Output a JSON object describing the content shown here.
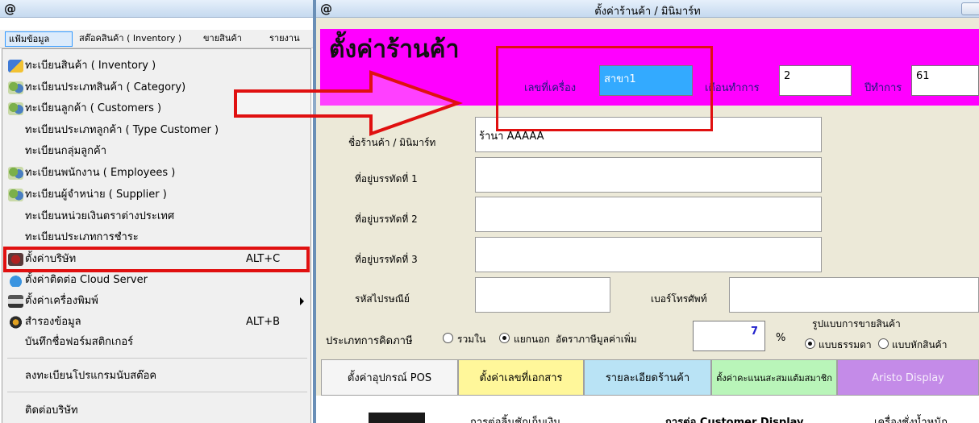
{
  "left_window": {
    "logo": "@",
    "menubar": [
      {
        "label": "แฟ้มข้อมูล",
        "active": true
      },
      {
        "label": "สต๊อคสินค้า ( Inventory )"
      },
      {
        "label": "ขายสินค้า"
      },
      {
        "label": "รายงาน"
      }
    ],
    "menu_items": [
      {
        "label": "ทะเบียนสินค้า ( Inventory )",
        "icon": "product-list-icon"
      },
      {
        "label": "ทะเบียนประเภทสินค้า ( Category)",
        "icon": "people-icon"
      },
      {
        "label": "ทะเบียนลูกค้า ( Customers )",
        "icon": "people-icon"
      },
      {
        "label": "ทะเบียนประเภทลูกค้า ( Type Customer )"
      },
      {
        "label": "ทะเบียนกลุ่มลูกค้า"
      },
      {
        "label": "ทะเบียนพนักงาน ( Employees )",
        "icon": "people-icon"
      },
      {
        "label": "ทะเบียนผู้จำหน่าย ( Supplier )",
        "icon": "people-icon"
      },
      {
        "label": "ทะเบียนหน่วยเงินตราต่างประเทศ"
      },
      {
        "label": "ทะเบียนประเภทการชำระ"
      },
      {
        "label": "ตั้งค่าบริษัท",
        "shortcut": "ALT+C",
        "icon": "company-settings-icon"
      },
      {
        "label": "ตั้งค่าติดต่อ Cloud Server",
        "icon": "cloud-icon"
      },
      {
        "label": "ตั้งค่าเครื่องพิมพ์",
        "icon": "printer-icon",
        "submenu": true
      },
      {
        "label": "สำรองข้อมูล",
        "shortcut": "ALT+B",
        "icon": "backup-icon"
      },
      {
        "label": "บันทึกชื่อฟอร์มสติกเกอร์"
      },
      {
        "label": "ลงทะเบียนโปรแกรมนับสต๊อค"
      },
      {
        "label": "ติดต่อบริษัท"
      }
    ]
  },
  "right_window": {
    "logo": "@",
    "title": "ตั้งค่าร้านค้า / มินิมาร์ท",
    "header": {
      "big_title": "ตั้งค่าร้านค้า",
      "machine_label": "เลขที่เครื่อง",
      "machine_value": "สาขา1",
      "month_label": "เดือนทำการ",
      "month_value": "2",
      "year_label": "ปีทำการ",
      "year_value": "61"
    },
    "form": {
      "shop_name_label": "ชื่อร้านค้า / มินิมาร์ท",
      "shop_name_value": "ร้านา AAAAA",
      "address1_label": "ที่อยู่บรรทัดที่ 1",
      "address2_label": "ที่อยู่บรรทัดที่ 2",
      "address3_label": "ที่อยู่บรรทัดที่ 3",
      "postcode_label": "รหัสไปรษณีย์",
      "phone_label": "เบอร์โทรศัพท์"
    },
    "tax": {
      "type_label": "ประเภทการคิดภาษี",
      "option_include": "รวมใน",
      "option_exclude": "แยกนอก",
      "vat_label": "อัตราภาษีมูลค่าเพิ่ม",
      "vat_value": "7",
      "percent": "%",
      "sale_mode_label": "รูปแบบการขายสินค้า",
      "sale_normal": "แบบธรรมดา",
      "sale_stock": "แบบหักสินค้า"
    },
    "tabs": [
      {
        "label": "ตั้งค่าอุปกรณ์ POS",
        "color": "#f5f5f5"
      },
      {
        "label": "ตั้งค่าเลขที่เอกสาร",
        "color": "#fff79a"
      },
      {
        "label": "รายละเอียดร้านค้า",
        "color": "#b9e3f5"
      },
      {
        "label": "ตั้งค่าคะแนนสะสมแต้มสมาชิก",
        "color": "#b9f5b9"
      },
      {
        "label": "Aristo Display",
        "color": "#c48be8"
      }
    ],
    "bottom": {
      "cash_drawer": "การต่อลิ้นชักเก็บเงิน",
      "customer_display": "การต่อ Customer Display",
      "scale": "เครื่องชั่งน้ำหนัก"
    }
  },
  "colors": {
    "magenta": "#ff00ff",
    "highlight_red": "#e01010",
    "selected_blue": "#33aaff"
  }
}
